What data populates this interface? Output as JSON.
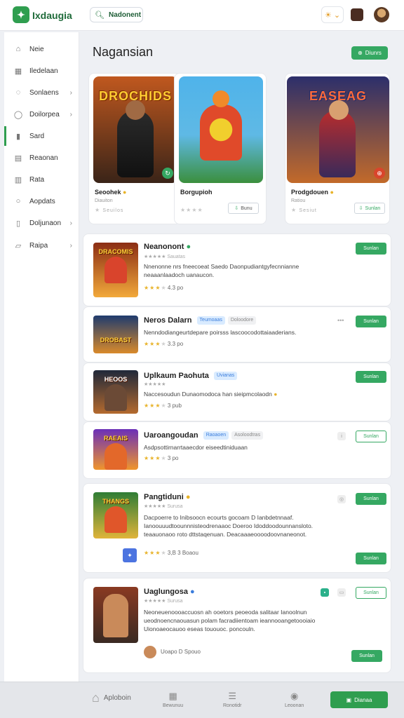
{
  "header": {
    "logo_text": "Ixdaugia",
    "search_label": "Nadonent",
    "chip_icon": "sun-icon"
  },
  "sidebar": {
    "items": [
      {
        "label": "Neie",
        "icon": "home-icon",
        "chevron": false
      },
      {
        "label": "Iledelaan",
        "icon": "grid-icon",
        "chevron": false
      },
      {
        "label": "Sonlaens",
        "icon": "chat-icon",
        "chevron": true
      },
      {
        "label": "Doilorpea",
        "icon": "shield-icon",
        "chevron": true
      },
      {
        "label": "Sard",
        "icon": "bar-icon",
        "chevron": false
      },
      {
        "label": "Reaonan",
        "icon": "building-icon",
        "chevron": false
      },
      {
        "label": "Rata",
        "icon": "table-icon",
        "chevron": false
      },
      {
        "label": "Aopdats",
        "icon": "bubble-icon",
        "chevron": false
      },
      {
        "label": "Doljunaon",
        "icon": "doc-icon",
        "chevron": true
      },
      {
        "label": "Raipa",
        "icon": "clipboard-icon",
        "chevron": true
      }
    ]
  },
  "main": {
    "title": "Nagansian",
    "top_button": "Diunrs",
    "featured": [
      {
        "art_title": "DROCHIDS",
        "name": "Seoohek",
        "sub": "Diauiton",
        "rating": "Seuilos",
        "button": "",
        "corner": "↻",
        "corner_color": "#35a862",
        "colors": [
          "#8a3a1d",
          "#2a1b18"
        ]
      },
      {
        "art_title": "",
        "name": "Borgupioh",
        "sub": "",
        "rating": "",
        "button": "Bunu",
        "corner": "",
        "corner_color": "",
        "colors": [
          "#58b6e8",
          "#3d9b45"
        ]
      },
      {
        "art_title": "EASEAG",
        "name": "Prodgdouen",
        "sub": "Ratiou",
        "rating": "Sesiut",
        "button": "Sunlan",
        "corner": "⊕",
        "corner_color": "#d9452c",
        "colors": [
          "#3c2a6e",
          "#c45a2a"
        ]
      }
    ],
    "items": [
      {
        "title": "Neanonont",
        "badges": [],
        "sub": "Sauatas",
        "desc": "Nnenonne nrs fneecoeat Saedo Daonpudiantgyfecnnianne neaaanlaadoch uanaucon.",
        "rating": "4.3 po",
        "button": "Sunlan",
        "button_style": "solid",
        "art": "DRACOMIS",
        "colors": [
          "#8b2d14",
          "#f2a93b"
        ]
      },
      {
        "title": "Neros Dalarn",
        "badges": [
          {
            "text": "Teumoaas",
            "style": "blue"
          },
          {
            "text": "Doloodore",
            "style": "gray"
          }
        ],
        "sub": "",
        "desc": "Nenndodiangeurtdepare poirsss lascoocodottaiaaderians.",
        "rating": "3.3 po",
        "button": "Sunlan",
        "button_style": "solid",
        "art": "DROBAST",
        "colors": [
          "#1f3b6e",
          "#d98a2b"
        ]
      },
      {
        "title": "Uplkaum Paohuta",
        "badges": [
          {
            "text": "Uvianas",
            "style": "blue"
          }
        ],
        "sub": "",
        "desc": "Naccesoudun Dunaomodoca han sieipmcolaodn",
        "rating": "3 pub",
        "button": "Sunlan",
        "button_style": "solid",
        "art": "HEOOS",
        "colors": [
          "#20283a",
          "#b46a2e"
        ]
      },
      {
        "title": "Uaroangoudan",
        "badges": [
          {
            "text": "Raoaoen",
            "style": "blue"
          },
          {
            "text": "Asoloodtras",
            "style": "gray"
          }
        ],
        "sub": "",
        "desc": "Asdpsottirnarrtaaecdor eiseedtiniduaan",
        "rating": "3 po",
        "button": "Sunlan",
        "button_style": "outline",
        "art": "RAEAIS",
        "colors": [
          "#6b2fb8",
          "#f0952c"
        ]
      },
      {
        "title": "Pangtiduni",
        "badges": [],
        "sub": "Surusa",
        "desc": "Dacpoerre to Inibsoocn ecourts gocoam D Ianbdetnnaaf. Ianoouuudtoounnnisteodrenaaoc Doeroo Idoddoodounnansloto. teaauonaoo roto dttstaqenuan. Deacaaaeoooodoovnaneonot.",
        "rating": "3,B 3 Boaou",
        "button": "Sunlan",
        "button_style": "solid",
        "art": "THANGS",
        "colors": [
          "#2f7d35",
          "#e0b43a"
        ]
      },
      {
        "title": "Uaglungosa",
        "badges": [],
        "sub": "Surusa",
        "desc": "Neoneuenoooaccuosn ah ooetors peoeoda salitaar Ianoolnun ueodnoencnaouasun polam facradiientoam ieannooangetoooiaio Uionoaeocauoo eseas tououoc. poncouln.",
        "rating": "Uoapo D Spouo",
        "button": "Sunlan",
        "button_style": "outline",
        "art": "",
        "colors": [
          "#8a3a22",
          "#3a2a22"
        ]
      }
    ]
  },
  "bottom_nav": {
    "main_label": "Aploboin",
    "items": [
      {
        "label": "Bewunuu",
        "icon": "calendar-icon"
      },
      {
        "label": "Ronotidr",
        "icon": "list-icon"
      },
      {
        "label": "Leoonan",
        "icon": "compass-icon"
      }
    ],
    "cta": "Dianaa"
  }
}
